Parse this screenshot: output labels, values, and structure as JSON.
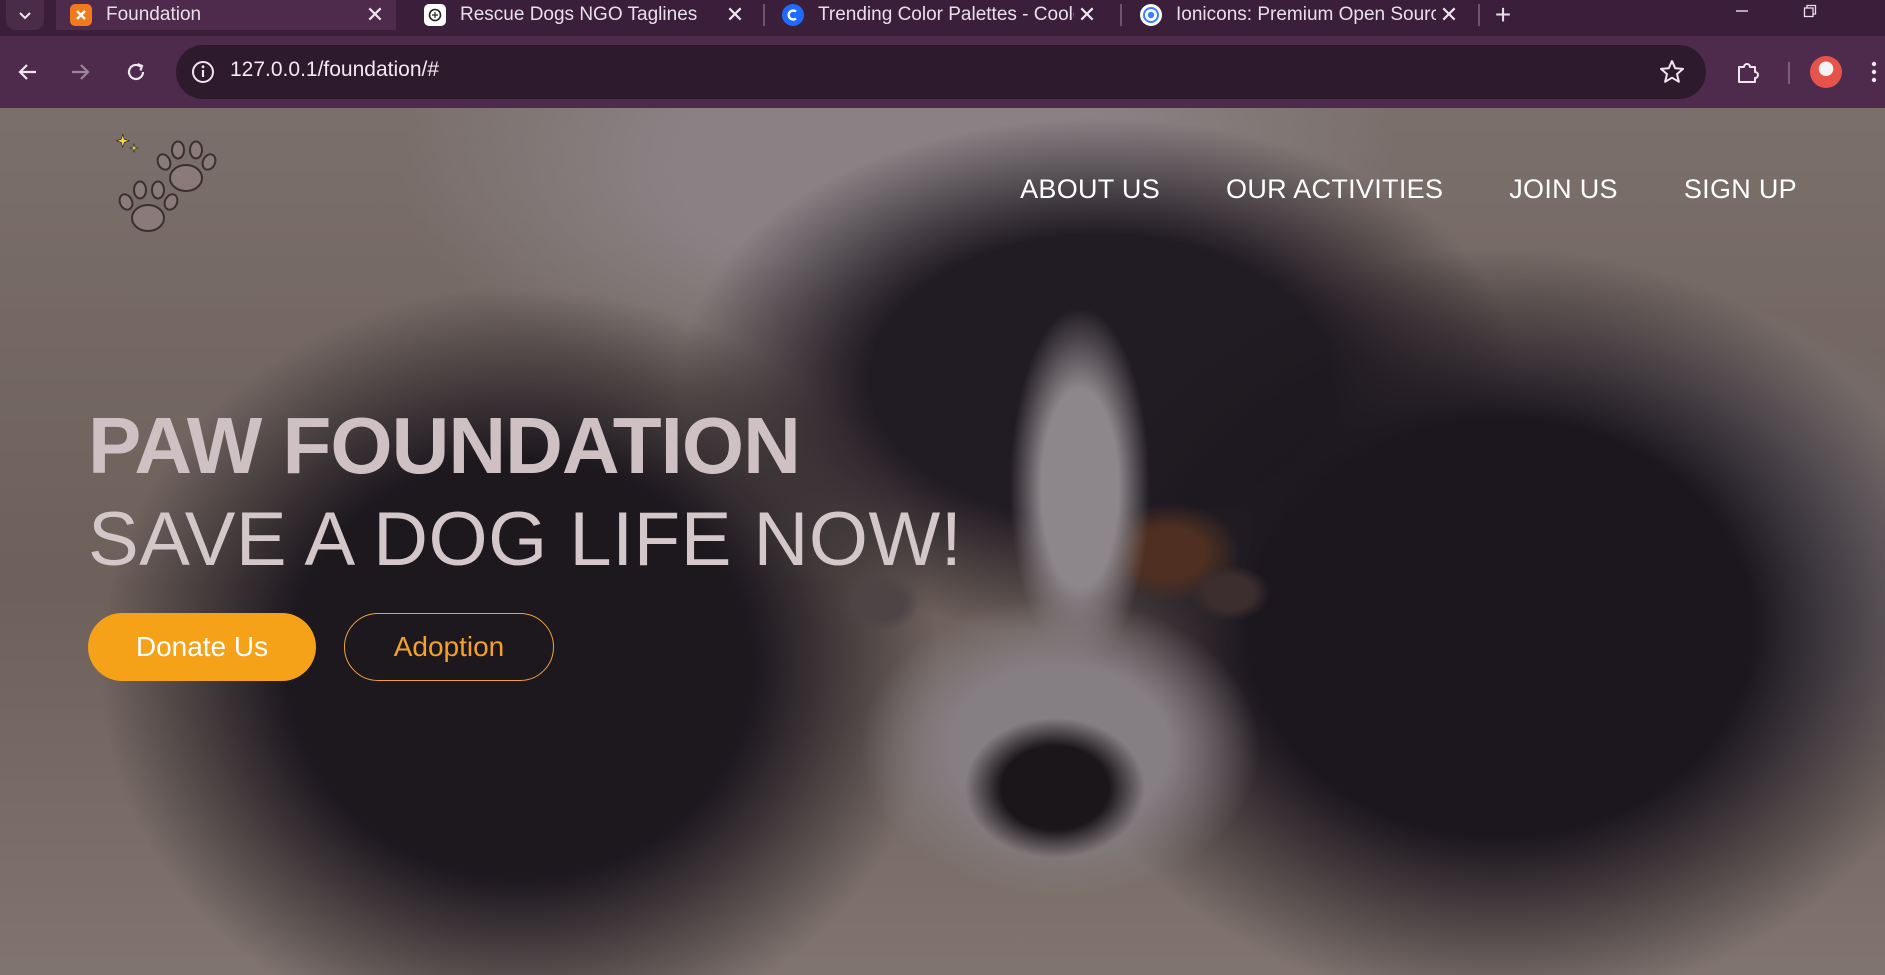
{
  "browser": {
    "tabs": [
      {
        "title": "Foundation",
        "active": true,
        "favicon": "xampp-icon"
      },
      {
        "title": "Rescue Dogs NGO Taglines",
        "active": false,
        "favicon": "chatgpt-icon"
      },
      {
        "title": "Trending Color Palettes - Coolors",
        "active": false,
        "favicon": "coolors-icon"
      },
      {
        "title": "Ionicons: Premium Open Source",
        "active": false,
        "favicon": "ionicons-icon"
      }
    ],
    "address": "127.0.0.1/foundation/#",
    "colors": {
      "frame": "#3b1f3a",
      "toolbar": "#4e2a4c",
      "omnibox": "#2e1a2d"
    }
  },
  "site": {
    "nav": [
      "ABOUT US",
      "OUR ACTIVITIES",
      "JOIN US",
      "SIGN UP"
    ],
    "hero": {
      "title": "PAW FOUNDATION",
      "subtitle": "SAVE A DOG LIFE NOW!"
    },
    "buttons": {
      "donate": "Donate Us",
      "adopt": "Adoption"
    },
    "colors": {
      "accent": "#f5a218",
      "hero_text": "#cfc1c3"
    }
  }
}
